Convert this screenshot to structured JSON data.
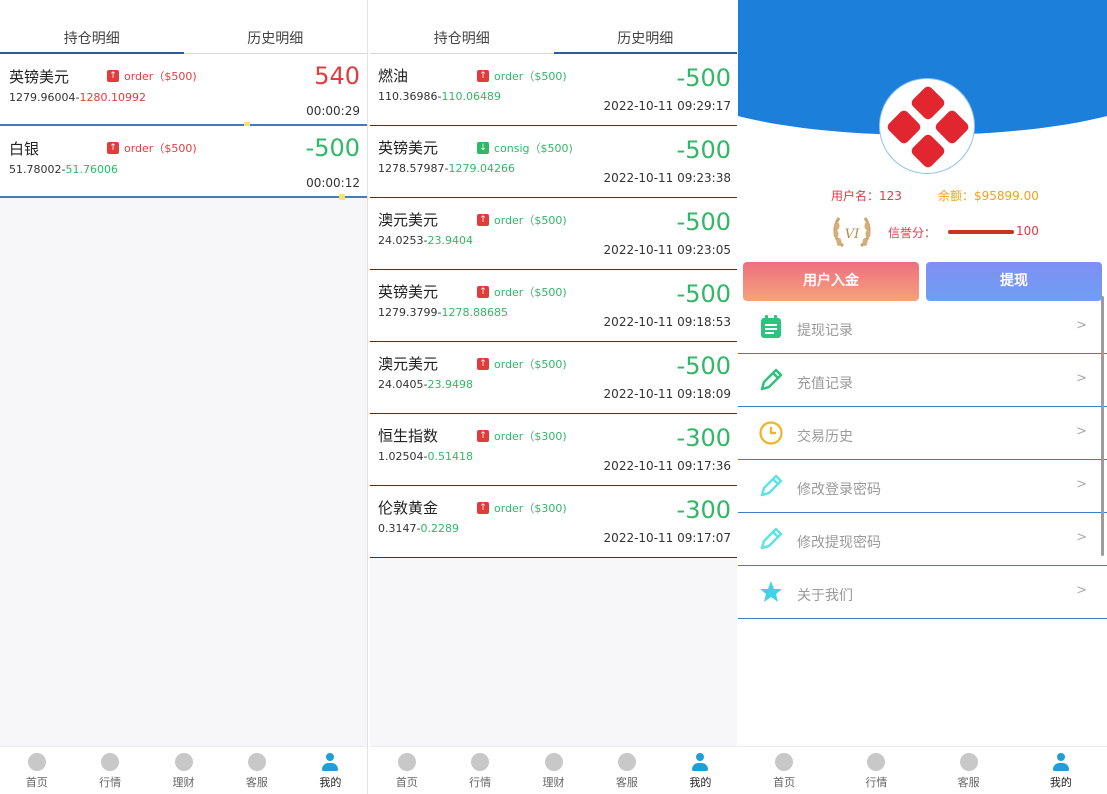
{
  "panel1": {
    "tabs": [
      {
        "label": "持仓明细",
        "active": true
      },
      {
        "label": "历史明细",
        "active": false
      }
    ],
    "positions": [
      {
        "name": "英镑美元",
        "direction": "up",
        "badge": "order（$500)",
        "price_open": "1279.96004",
        "price_now": "1280.10992",
        "price_now_color": "red",
        "amount": "540",
        "amount_color": "red",
        "time": "00:00:29",
        "dot_position": 0.67
      },
      {
        "name": "白银",
        "direction": "up",
        "badge": "order（$500)",
        "price_open": "51.78002",
        "price_now": "51.76006",
        "price_now_color": "green",
        "amount": "-500",
        "amount_color": "green",
        "time": "00:00:12",
        "dot_position": 0.93
      }
    ]
  },
  "panel2": {
    "tabs": [
      {
        "label": "持仓明细",
        "active": false
      },
      {
        "label": "历史明细",
        "active": true
      }
    ],
    "history": [
      {
        "name": "燃油",
        "direction": "up",
        "badge": "order（$500)",
        "price_open": "110.36986",
        "price_close": "110.06489",
        "amount": "-500",
        "time": "2022-10-11 09:29:17"
      },
      {
        "name": "英镑美元",
        "direction": "down",
        "badge": "consig（$500)",
        "price_open": "1278.57987",
        "price_close": "1279.04266",
        "amount": "-500",
        "time": "2022-10-11 09:23:38"
      },
      {
        "name": "澳元美元",
        "direction": "up",
        "badge": "order（$500)",
        "price_open": "24.0253",
        "price_close": "23.9404",
        "amount": "-500",
        "time": "2022-10-11 09:23:05"
      },
      {
        "name": "英镑美元",
        "direction": "up",
        "badge": "order（$500)",
        "price_open": "1279.3799",
        "price_close": "1278.88685",
        "amount": "-500",
        "time": "2022-10-11 09:18:53"
      },
      {
        "name": "澳元美元",
        "direction": "up",
        "badge": "order（$500)",
        "price_open": "24.0405",
        "price_close": "23.9498",
        "amount": "-500",
        "time": "2022-10-11 09:18:09"
      },
      {
        "name": "恒生指数",
        "direction": "up",
        "badge": "order（$300)",
        "price_open": "1.02504",
        "price_close": "0.51418",
        "amount": "-300",
        "time": "2022-10-11 09:17:36"
      },
      {
        "name": "伦敦黄金",
        "direction": "up",
        "badge": "order（$300)",
        "price_open": "0.3147",
        "price_close": "0.2289",
        "amount": "-300",
        "time": "2022-10-11 09:17:07"
      }
    ]
  },
  "panel3": {
    "username_text": "用户名：123",
    "balance_text": "余额：$95899.00",
    "vip_badge": "VI",
    "credit_label": "信誉分：",
    "credit_value": "100",
    "deposit_label": "用户入金",
    "withdraw_label": "提现",
    "menu": [
      {
        "label": "提现记录",
        "icon": "notepad-icon",
        "color": "#2ec27e"
      },
      {
        "label": "充值记录",
        "icon": "pencil-icon",
        "color": "#2ec27e"
      },
      {
        "label": "交易历史",
        "icon": "clock-icon",
        "color": "#f0b429"
      },
      {
        "label": "修改登录密码",
        "icon": "pencil-icon",
        "color": "#5fe3e3"
      },
      {
        "label": "修改提现密码",
        "icon": "pencil-icon",
        "color": "#5fe3e3"
      },
      {
        "label": "关于我们",
        "icon": "star-icon",
        "color": "#3fd3e8"
      }
    ],
    "chevron": ">"
  },
  "bottom_nav": [
    {
      "label": "首页",
      "icon": "home-icon"
    },
    {
      "label": "行情",
      "icon": "chart-icon"
    },
    {
      "label": "理财",
      "icon": "finance-icon"
    },
    {
      "label": "客服",
      "icon": "headset-icon"
    },
    {
      "label": "我的",
      "icon": "user-icon",
      "active": true
    }
  ],
  "bottom_nav_p3": [
    {
      "label": "首页",
      "icon": "home-icon"
    },
    {
      "label": "行情",
      "icon": "chart-icon"
    },
    {
      "label": "客服",
      "icon": "headset-icon"
    },
    {
      "label": "我的",
      "icon": "user-icon",
      "active": true
    }
  ],
  "colors": {
    "accent_blue": "#1c7fd9",
    "up_red": "#e23b3b",
    "down_green": "#2fb866",
    "row_divider": "#3e7cc6"
  }
}
